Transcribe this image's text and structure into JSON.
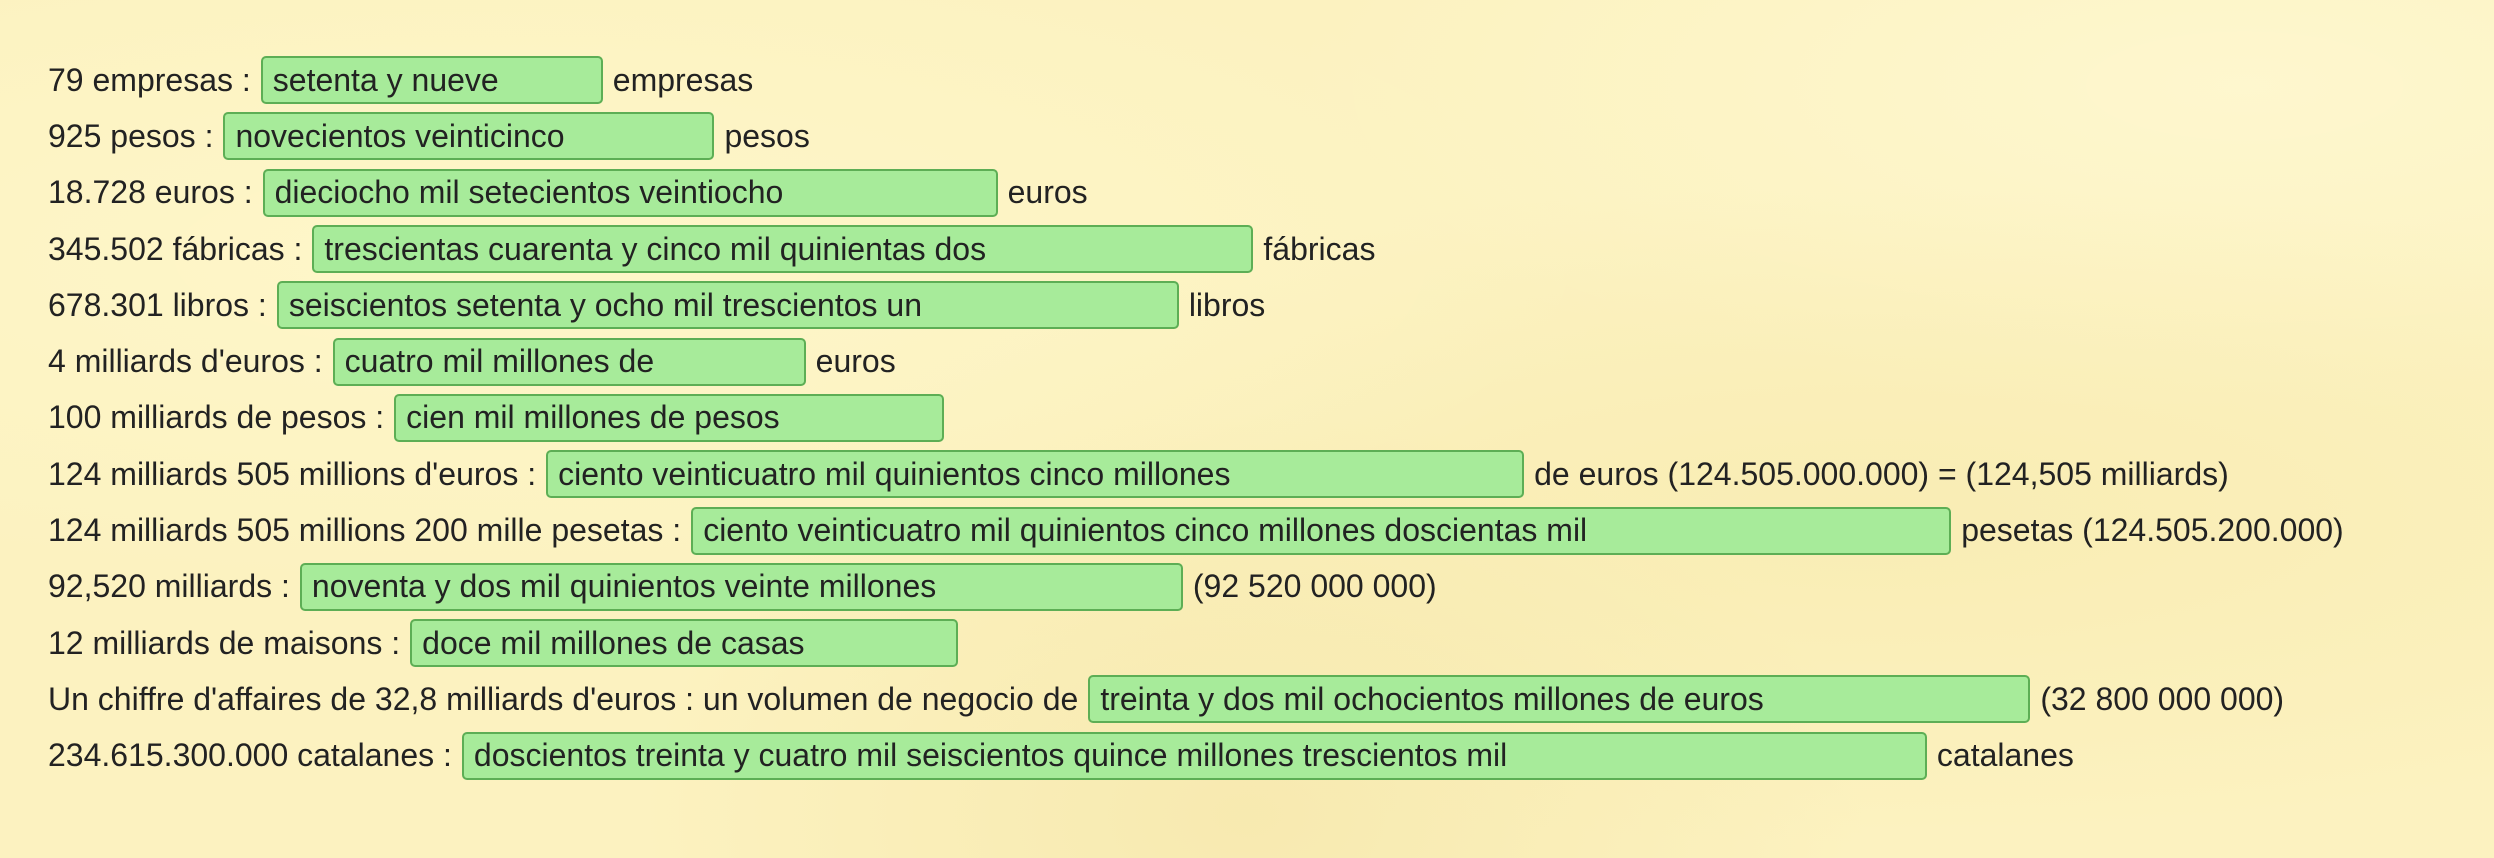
{
  "rows": [
    {
      "prompt": "79 empresas :",
      "answer": "setenta y nueve",
      "suffix": "empresas"
    },
    {
      "prompt": "925 pesos :",
      "answer": "novecientos veinticinco",
      "suffix": "pesos"
    },
    {
      "prompt": "18.728 euros :",
      "answer": "dieciocho mil setecientos veintiocho",
      "suffix": "euros"
    },
    {
      "prompt": "345.502 fábricas :",
      "answer": "trescientas cuarenta y cinco mil quinientas dos",
      "suffix": "fábricas"
    },
    {
      "prompt": "678.301 libros :",
      "answer": "seiscientos setenta y ocho mil trescientos un",
      "suffix": "libros"
    },
    {
      "prompt": "4 milliards d'euros :",
      "answer": "cuatro mil millones de",
      "suffix": "euros"
    },
    {
      "prompt": "100 milliards de pesos :",
      "answer": "cien mil millones de pesos",
      "suffix": ""
    },
    {
      "prompt": "124 milliards 505 millions d'euros :",
      "answer": "ciento veinticuatro mil quinientos cinco millones",
      "suffix": "de euros (124.505.000.000) = (124,505 milliards)"
    },
    {
      "prompt": "124 milliards 505 millions 200 mille pesetas :",
      "answer": "ciento veinticuatro mil quinientos cinco millones doscientas mil",
      "suffix": "pesetas (124.505.200.000)"
    },
    {
      "prompt": "92,520 milliards :",
      "answer": "noventa y dos mil quinientos veinte millones",
      "suffix": "(92 520 000 000)"
    },
    {
      "prompt": "12 milliards de maisons :",
      "answer": "doce mil millones de casas",
      "suffix": ""
    },
    {
      "prompt": "Un chiffre d'affaires de 32,8 milliards d'euros : un volumen de negocio de",
      "answer": "treinta y dos mil ochocientos millones de euros",
      "suffix": "(32 800 000 000)"
    },
    {
      "prompt": "234.615.300.000 catalanes :",
      "answer": "doscientos treinta y cuatro mil seiscientos quince millones trescientos mil",
      "suffix": "catalanes"
    }
  ],
  "colors": {
    "background": "#fcf2c0",
    "answer_fill": "#a7eb9a",
    "answer_border": "#5dae55",
    "text": "#222222"
  }
}
